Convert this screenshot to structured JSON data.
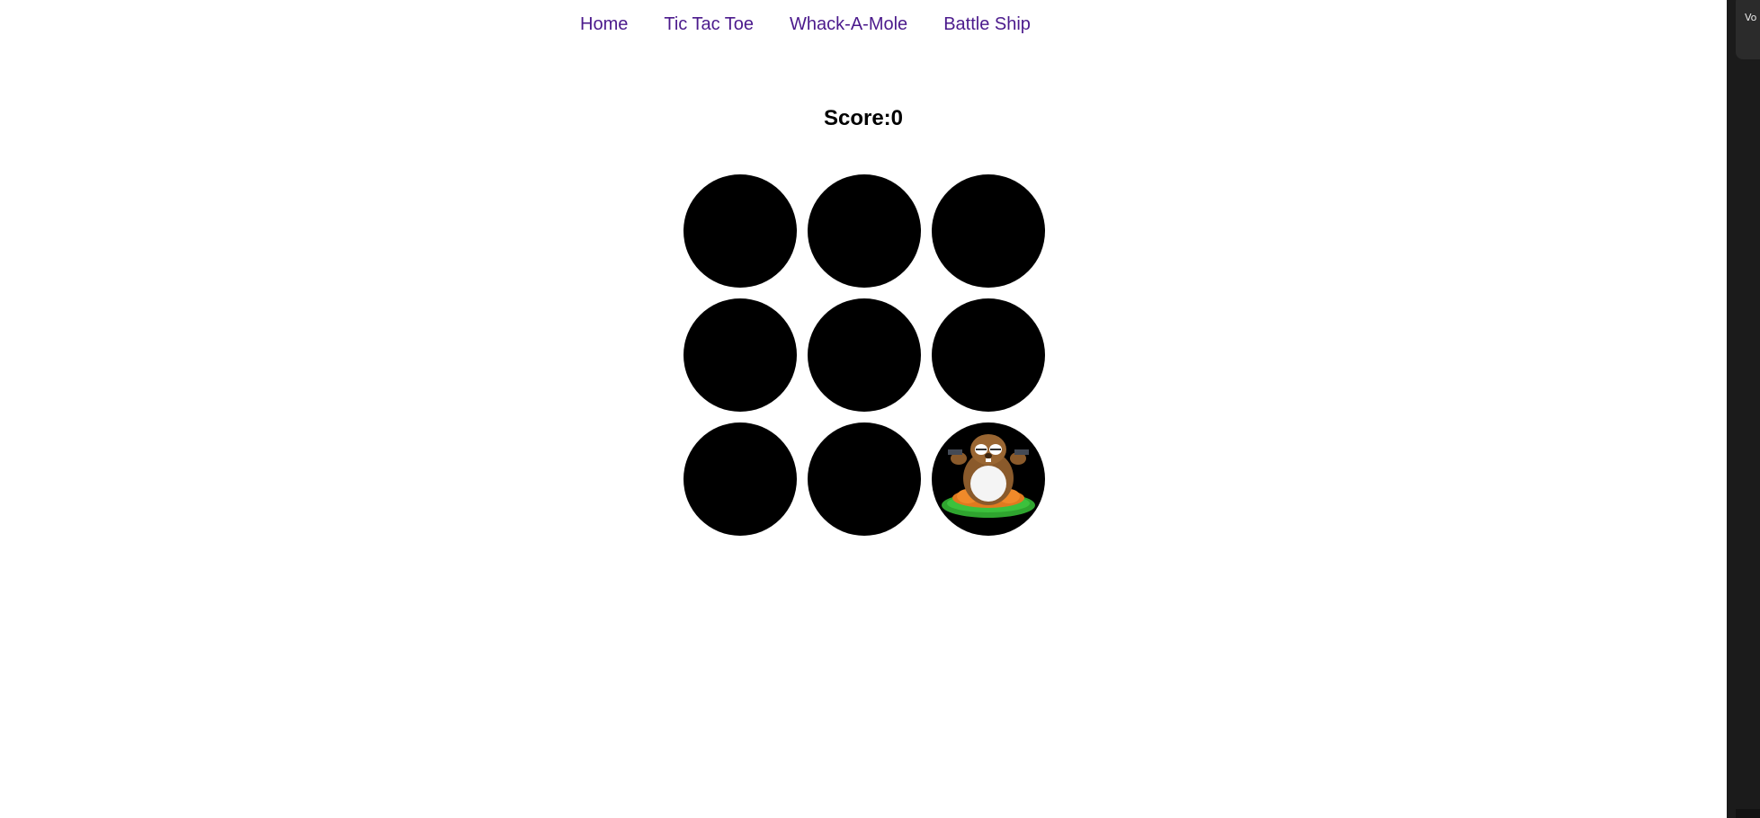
{
  "nav": {
    "items": [
      {
        "label": "Home"
      },
      {
        "label": "Tic Tac Toe"
      },
      {
        "label": "Whack-A-Mole"
      },
      {
        "label": "Battle Ship"
      }
    ],
    "link_color": "#4b1a8c"
  },
  "score": {
    "label": "Score:",
    "value": "0"
  },
  "board": {
    "holes": [
      {
        "mole": false
      },
      {
        "mole": false
      },
      {
        "mole": false
      },
      {
        "mole": false
      },
      {
        "mole": false
      },
      {
        "mole": false
      },
      {
        "mole": false
      },
      {
        "mole": false
      },
      {
        "mole": true,
        "icon": "mole-icon"
      }
    ],
    "hole_color": "#000000"
  },
  "side_panel": {
    "text": "Vo"
  }
}
